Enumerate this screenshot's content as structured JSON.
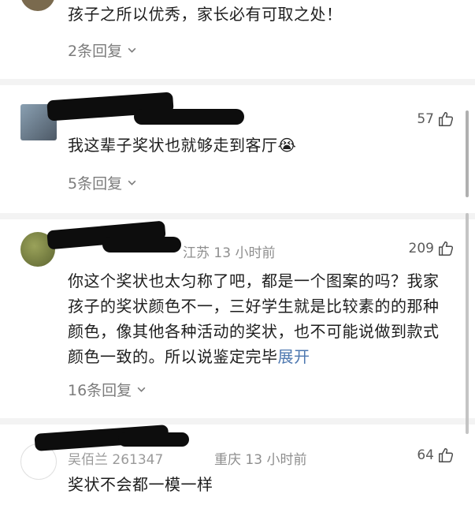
{
  "comments": [
    {
      "text": "孩子之所以优秀，家长必有可取之处！",
      "replies": "2条回复"
    },
    {
      "likes": "57",
      "text": "我这辈子奖状也就够走到客厅😭",
      "replies": "5条回复"
    },
    {
      "location_time": "江苏 13 小时前",
      "likes": "209",
      "text": "你这个奖状也太匀称了吧，都是一个图案的吗？我家孩子的奖状颜色不一，三好学生就是比较素的的那种颜色，像其他各种活动的奖状，也不可能说做到款式颜色一致的。所以说鉴定完毕",
      "expand": "展开",
      "replies": "16条回复"
    },
    {
      "username": "吴佰兰 261347",
      "location_time": "重庆 13 小时前",
      "likes": "64",
      "text": "奖状不会都一模一样"
    }
  ],
  "colors": {
    "accent": "#4e78b0",
    "meta": "#8e8e8e",
    "separator": "#f3f3f3"
  },
  "icons": {
    "like": "thumbs-up-icon",
    "expand_replies": "chevron-down-icon"
  }
}
